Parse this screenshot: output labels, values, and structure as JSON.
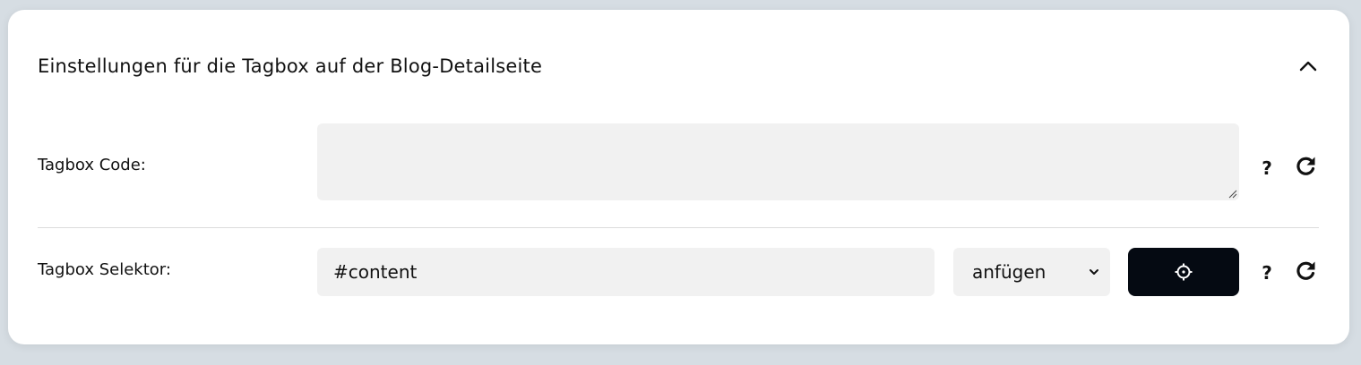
{
  "panel": {
    "title": "Einstellungen für die Tagbox auf der Blog-Detailseite",
    "collapse_icon": "chevron-up-icon"
  },
  "tagbox_code": {
    "label": "Tagbox Code:",
    "value": "",
    "help": "?",
    "reset_icon": "redo-icon"
  },
  "tagbox_selector": {
    "label": "Tagbox Selektor:",
    "value": "#content",
    "mode_selected": "anfügen",
    "picker_icon": "crosshair-icon",
    "help": "?",
    "reset_icon": "redo-icon"
  },
  "colors": {
    "card_bg": "#ffffff",
    "page_bg": "#d6dde3",
    "field_bg": "#f1f1f1",
    "button_bg": "#050a12"
  }
}
